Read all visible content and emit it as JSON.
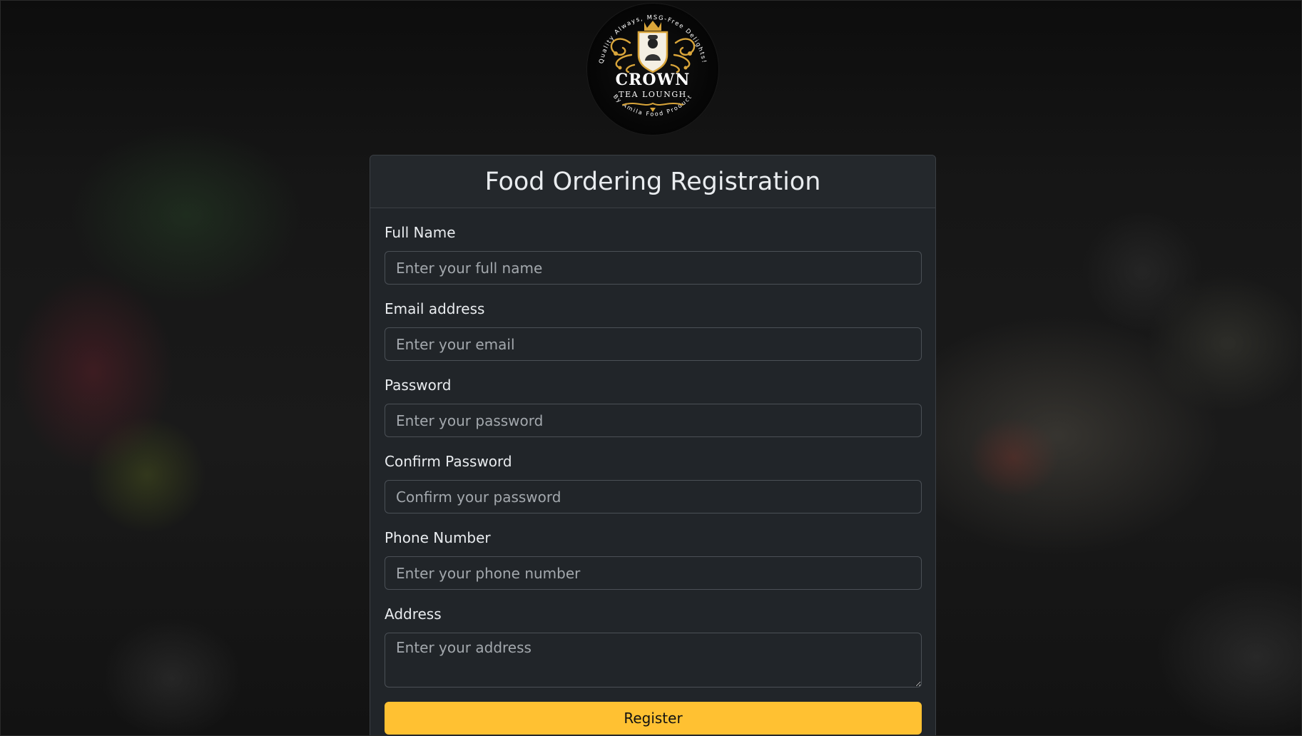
{
  "logo": {
    "title": "CROWN",
    "subtitle": "TEA LOUNGH",
    "ring_top_text": "Quality Always, MSG-Free Delights!",
    "ring_bottom_text": "By Amila Food Product",
    "accent_color": "#d9a53a"
  },
  "form": {
    "title": "Food Ordering Registration",
    "fields": [
      {
        "label": "Full Name",
        "placeholder": "Enter your full name",
        "type": "text",
        "value": ""
      },
      {
        "label": "Email address",
        "placeholder": "Enter your email",
        "type": "email",
        "value": ""
      },
      {
        "label": "Password",
        "placeholder": "Enter your password",
        "type": "password",
        "value": ""
      },
      {
        "label": "Confirm Password",
        "placeholder": "Confirm your password",
        "type": "password",
        "value": ""
      },
      {
        "label": "Phone Number",
        "placeholder": "Enter your phone number",
        "type": "tel",
        "value": ""
      }
    ],
    "address": {
      "label": "Address",
      "placeholder": "Enter your address",
      "value": ""
    },
    "submit_label": "Register",
    "button_color": "#ffc132"
  }
}
